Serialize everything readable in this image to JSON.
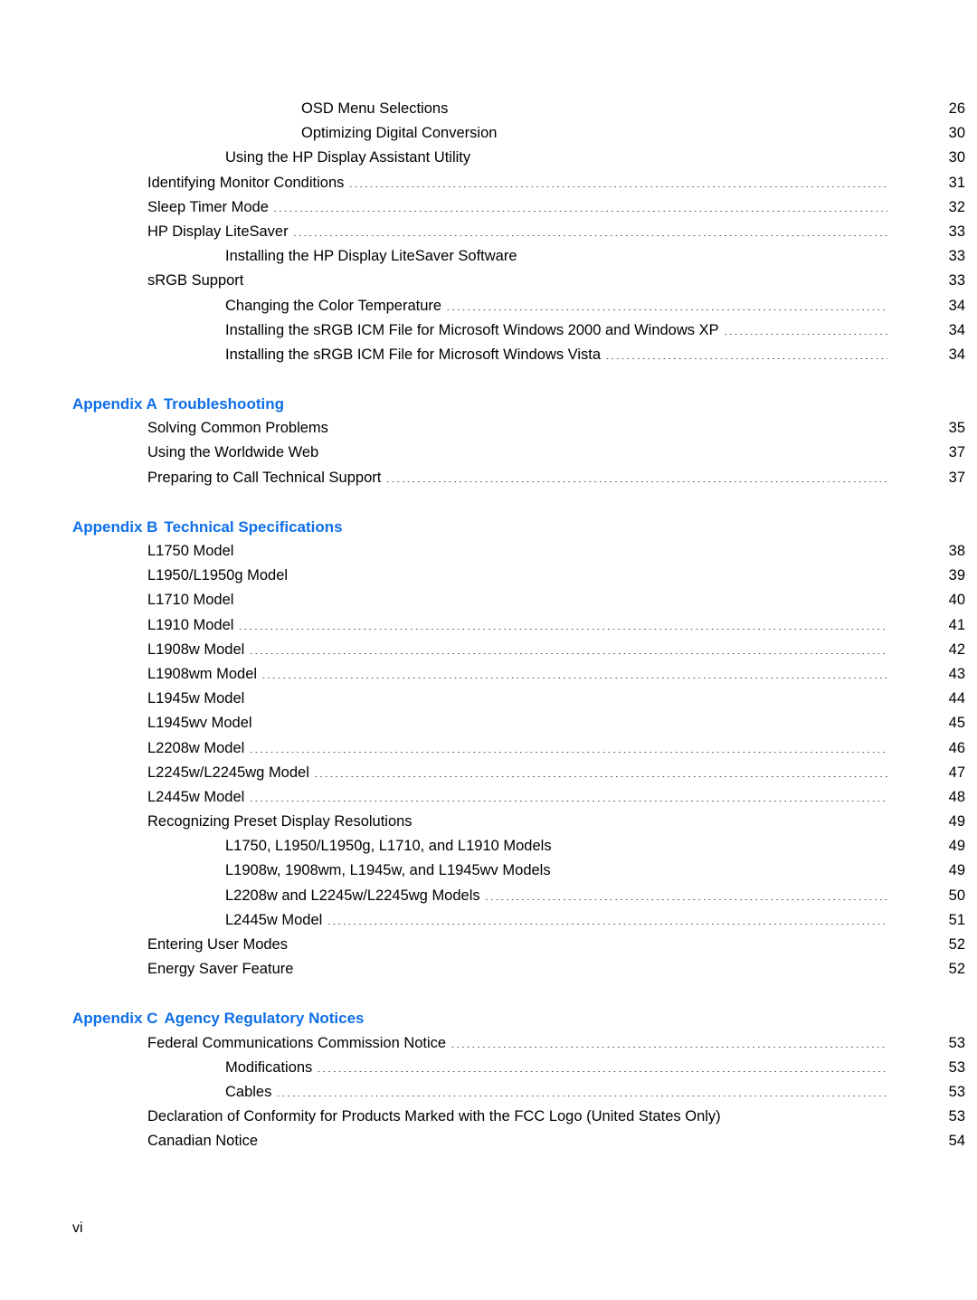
{
  "document": {
    "type": "table-of-contents",
    "folio": "vi",
    "heading_color": "#0f6fe8",
    "text_color": "#000000",
    "background_color": "#ffffff"
  },
  "toc": {
    "blocks": [
      {
        "heading": null,
        "entries": [
          {
            "title": "OSD Menu Selections",
            "page": "26",
            "level": 3
          },
          {
            "title": "Optimizing Digital Conversion",
            "page": "30",
            "level": 3
          },
          {
            "title": "Using the HP Display Assistant Utility",
            "page": "30",
            "level": 2
          },
          {
            "title": "Identifying Monitor Conditions",
            "page": "31",
            "level": 1
          },
          {
            "title": "Sleep Timer Mode",
            "page": "32",
            "level": 1
          },
          {
            "title": "HP Display LiteSaver",
            "page": "33",
            "level": 1
          },
          {
            "title": "Installing the HP Display LiteSaver Software",
            "page": "33",
            "level": 2
          },
          {
            "title": "sRGB Support",
            "page": "33",
            "level": 1
          },
          {
            "title": "Changing the Color Temperature",
            "page": "34",
            "level": 2
          },
          {
            "title": "Installing the sRGB ICM File for Microsoft Windows 2000 and Windows XP",
            "page": "34",
            "level": 2
          },
          {
            "title": "Installing the sRGB ICM File for Microsoft Windows Vista",
            "page": "34",
            "level": 2
          }
        ]
      },
      {
        "heading": {
          "label": "Appendix A",
          "title": "Troubleshooting"
        },
        "entries": [
          {
            "title": "Solving Common Problems",
            "page": "35",
            "level": 1
          },
          {
            "title": "Using the Worldwide Web",
            "page": "37",
            "level": 1
          },
          {
            "title": "Preparing to Call Technical Support",
            "page": "37",
            "level": 1
          }
        ]
      },
      {
        "heading": {
          "label": "Appendix B",
          "title": "Technical Specifications"
        },
        "entries": [
          {
            "title": "L1750 Model",
            "page": "38",
            "level": 1
          },
          {
            "title": "L1950/L1950g Model",
            "page": "39",
            "level": 1
          },
          {
            "title": "L1710 Model",
            "page": "40",
            "level": 1
          },
          {
            "title": "L1910 Model",
            "page": "41",
            "level": 1
          },
          {
            "title": "L1908w Model",
            "page": "42",
            "level": 1
          },
          {
            "title": "L1908wm Model",
            "page": "43",
            "level": 1
          },
          {
            "title": "L1945w Model",
            "page": "44",
            "level": 1
          },
          {
            "title": "L1945wv Model",
            "page": "45",
            "level": 1
          },
          {
            "title": "L2208w Model",
            "page": "46",
            "level": 1
          },
          {
            "title": "L2245w/L2245wg Model",
            "page": "47",
            "level": 1
          },
          {
            "title": "L2445w Model",
            "page": "48",
            "level": 1
          },
          {
            "title": "Recognizing Preset Display Resolutions",
            "page": "49",
            "level": 1
          },
          {
            "title": "L1750, L1950/L1950g, L1710, and L1910 Models",
            "page": "49",
            "level": 2
          },
          {
            "title": "L1908w, 1908wm, L1945w, and L1945wv Models",
            "page": "49",
            "level": 2
          },
          {
            "title": "L2208w and L2245w/L2245wg Models",
            "page": "50",
            "level": 2
          },
          {
            "title": "L2445w Model",
            "page": "51",
            "level": 2
          },
          {
            "title": "Entering User Modes",
            "page": "52",
            "level": 1
          },
          {
            "title": "Energy Saver Feature",
            "page": "52",
            "level": 1
          }
        ]
      },
      {
        "heading": {
          "label": "Appendix C",
          "title": "Agency Regulatory Notices"
        },
        "entries": [
          {
            "title": "Federal Communications Commission Notice",
            "page": "53",
            "level": 1
          },
          {
            "title": "Modifications",
            "page": "53",
            "level": 2
          },
          {
            "title": "Cables",
            "page": "53",
            "level": 2
          },
          {
            "title": "Declaration of Conformity for Products Marked with the FCC Logo (United States Only)",
            "page": "53",
            "level": 1
          },
          {
            "title": "Canadian Notice",
            "page": "54",
            "level": 1
          }
        ]
      }
    ]
  }
}
